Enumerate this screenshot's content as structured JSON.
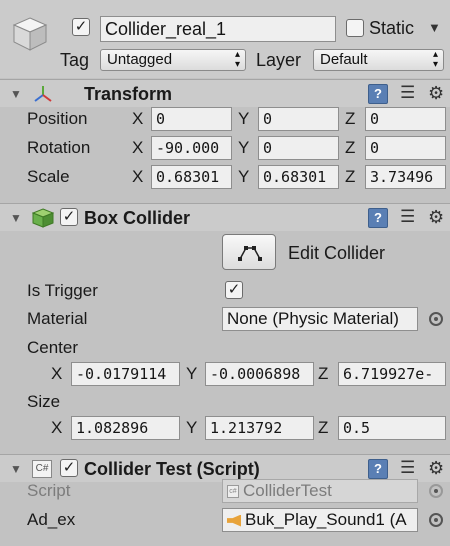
{
  "object": {
    "name": "Collider_real_1",
    "active": true,
    "static_label": "Static",
    "static_checked": false,
    "tag_label": "Tag",
    "tag_value": "Untagged",
    "layer_label": "Layer",
    "layer_value": "Default"
  },
  "transform": {
    "title": "Transform",
    "position": {
      "label": "Position",
      "x": "0",
      "y": "0",
      "z": "0"
    },
    "rotation": {
      "label": "Rotation",
      "x": "-90.000",
      "y": "0",
      "z": "0"
    },
    "scale": {
      "label": "Scale",
      "x": "0.68301",
      "y": "0.68301",
      "z": "3.73496"
    }
  },
  "box_collider": {
    "title": "Box Collider",
    "enabled": true,
    "edit_label": "Edit Collider",
    "is_trigger_label": "Is Trigger",
    "is_trigger": true,
    "material_label": "Material",
    "material_value": "None (Physic Material)",
    "center_label": "Center",
    "center": {
      "x": "-0.0179114",
      "y": "-0.0006898",
      "z": "6.719927e-"
    },
    "size_label": "Size",
    "size": {
      "x": "1.082896",
      "y": "1.213792",
      "z": "0.5"
    }
  },
  "script_component": {
    "title": "Collider Test (Script)",
    "enabled": true,
    "script_label": "Script",
    "script_value": "ColliderTest",
    "ad_ex_label": "Ad_ex",
    "ad_ex_value": "Buk_Play_Sound1 (A"
  },
  "axes": {
    "x": "X",
    "y": "Y",
    "z": "Z"
  },
  "colors": {
    "background": "#c2c2c2",
    "header": "#cbcbcb",
    "field": "#efefef",
    "help_icon": "#5a7fb4",
    "sound_icon": "#e8a33a",
    "cube_green": "#6ab04c"
  }
}
